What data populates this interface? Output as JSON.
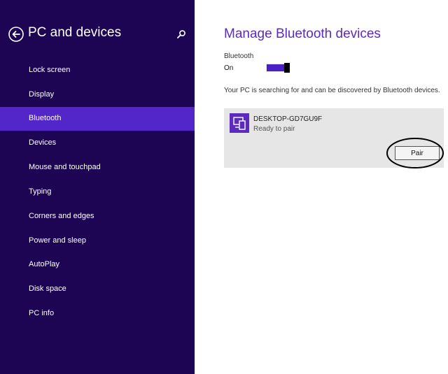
{
  "sidebar": {
    "title": "PC and devices",
    "items": [
      {
        "label": "Lock screen"
      },
      {
        "label": "Display"
      },
      {
        "label": "Bluetooth"
      },
      {
        "label": "Devices"
      },
      {
        "label": "Mouse and touchpad"
      },
      {
        "label": "Typing"
      },
      {
        "label": "Corners and edges"
      },
      {
        "label": "Power and sleep"
      },
      {
        "label": "AutoPlay"
      },
      {
        "label": "Disk space"
      },
      {
        "label": "PC info"
      }
    ],
    "selected": "Bluetooth"
  },
  "main": {
    "title": "Manage Bluetooth devices",
    "bluetooth_label": "Bluetooth",
    "bluetooth_state": "On",
    "status_text": "Your PC is searching for and can be discovered by Bluetooth devices.",
    "device": {
      "name": "DESKTOP-GD7GU9F",
      "status": "Ready to pair",
      "pair_label": "Pair"
    }
  },
  "colors": {
    "sidebar_bg": "#1d0553",
    "selected_bg": "#5326c9",
    "accent": "#5b2bbf",
    "card_bg": "#e6e6e6"
  },
  "icons": {
    "back": "back-arrow-icon",
    "search": "search-icon",
    "device": "device-icon"
  }
}
